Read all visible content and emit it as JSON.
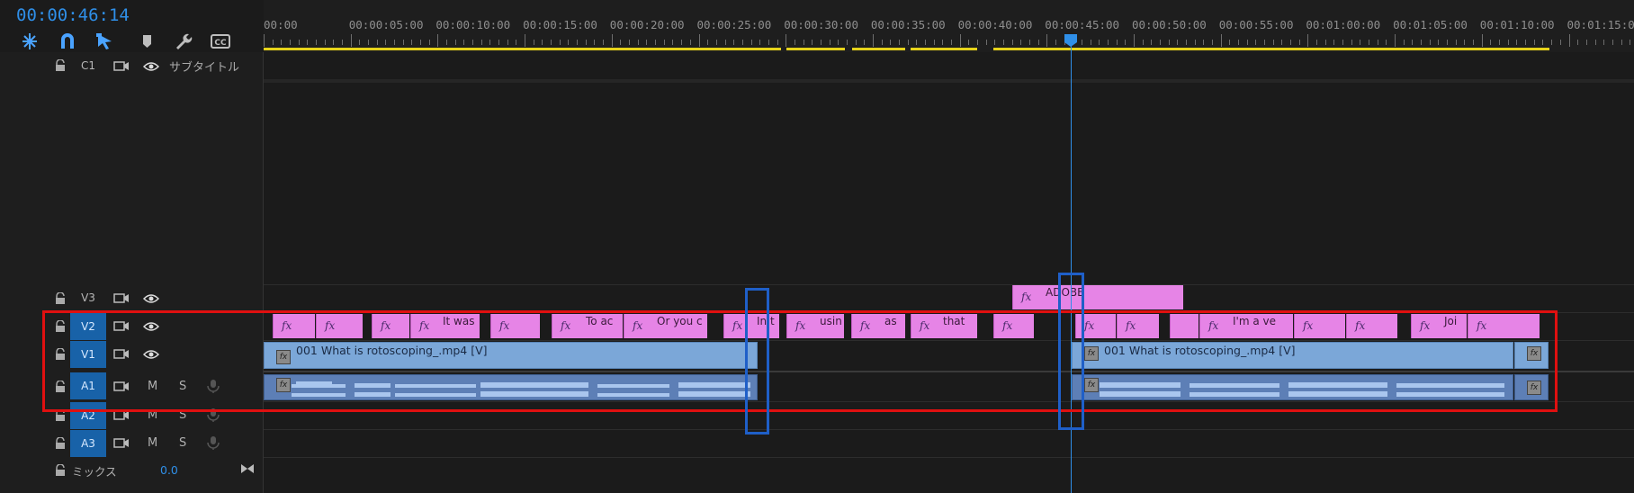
{
  "header": {
    "timecode": "00:00:46:14",
    "tools": [
      {
        "name": "snap-insert-icon"
      },
      {
        "name": "magnet-snap-icon"
      },
      {
        "name": "linked-selection-icon"
      },
      {
        "name": "add-marker-icon"
      },
      {
        "name": "wrench-settings-icon"
      },
      {
        "name": "captions-cc-icon"
      }
    ]
  },
  "ruler": {
    "ticks": [
      "00:00",
      "00:00:05:00",
      "00:00:10:00",
      "00:00:15:00",
      "00:00:20:00",
      "00:00:25:00",
      "00:00:30:00",
      "00:00:35:00",
      "00:00:40:00",
      "00:00:45:00",
      "00:00:50:00",
      "00:00:55:00",
      "00:01:00:00",
      "00:01:05:00",
      "00:01:10:00",
      "00:01:15:00"
    ]
  },
  "tracks": {
    "caption": {
      "name": "C1",
      "label": "サブタイトル"
    },
    "v3": {
      "name": "V3"
    },
    "v2": {
      "name": "V2"
    },
    "v1": {
      "name": "V1"
    },
    "a1": {
      "name": "A1",
      "m": "M",
      "s": "S"
    },
    "a2": {
      "name": "A2",
      "m": "M",
      "s": "S"
    },
    "a3": {
      "name": "A3",
      "m": "M",
      "s": "S"
    },
    "mix": {
      "label": "ミックス",
      "value": "0.0"
    }
  },
  "clips": {
    "v3_title": "ADOBE",
    "v2_texts": [
      "It was",
      "To ac",
      "Or you c",
      "In t",
      "usin",
      "as",
      "that",
      "I'm a ve",
      "Joi"
    ],
    "v1_clip_name": "001 What is rotoscoping_.mp4 [V]",
    "fx_label": "fx"
  },
  "colors": {
    "accent": "#2f8fe8",
    "title_clip": "#e684e6",
    "video_clip": "#7ba7d8",
    "audio_clip": "#5d7fb6",
    "workbar": "#e6d21a",
    "highlight_red": "#e01010",
    "highlight_blue": "#1f5fc8"
  }
}
